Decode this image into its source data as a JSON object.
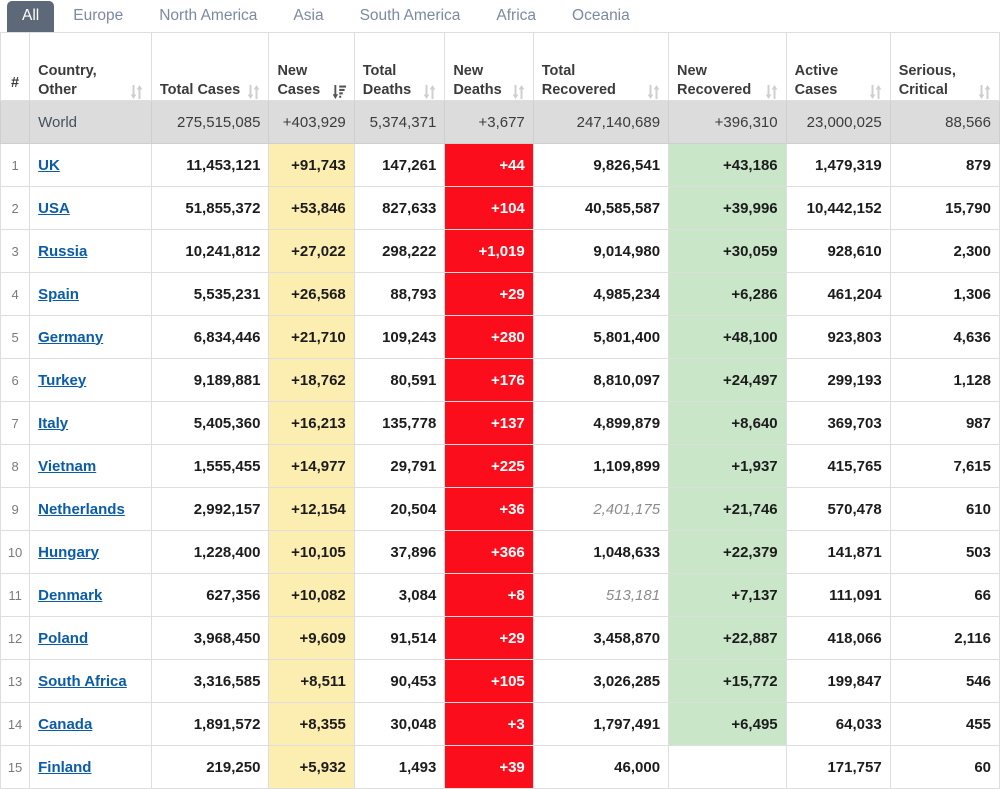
{
  "tabs": [
    {
      "label": "All",
      "active": true
    },
    {
      "label": "Europe",
      "active": false
    },
    {
      "label": "North America",
      "active": false
    },
    {
      "label": "Asia",
      "active": false
    },
    {
      "label": "South America",
      "active": false
    },
    {
      "label": "Africa",
      "active": false
    },
    {
      "label": "Oceania",
      "active": false
    }
  ],
  "colors": {
    "tab_active_bg": "#5d6878",
    "new_cases_bg": "#fcedb0",
    "new_deaths_bg": "#fc0d1b",
    "new_recovered_bg": "#c9e6c9",
    "world_row_bg": "#dcdcdc",
    "link": "#0b5ca8"
  },
  "table": {
    "headers": [
      {
        "label": "#",
        "sort": "none",
        "name": "rank"
      },
      {
        "label": "Country, Other",
        "sort": "both",
        "name": "country-other"
      },
      {
        "label": "Total Cases",
        "sort": "both",
        "name": "total-cases"
      },
      {
        "label": "New Cases",
        "sort": "desc",
        "name": "new-cases"
      },
      {
        "label": "Total Deaths",
        "sort": "both",
        "name": "total-deaths"
      },
      {
        "label": "New Deaths",
        "sort": "both",
        "name": "new-deaths"
      },
      {
        "label": "Total Recovered",
        "sort": "both",
        "name": "total-recovered"
      },
      {
        "label": "New Recovered",
        "sort": "both",
        "name": "new-recovered"
      },
      {
        "label": "Active Cases",
        "sort": "both",
        "name": "active-cases"
      },
      {
        "label": "Serious, Critical",
        "sort": "both",
        "name": "serious-critical"
      }
    ],
    "world": {
      "rank": "",
      "country": "World",
      "total_cases": "275,515,085",
      "new_cases": "+403,929",
      "total_deaths": "5,374,371",
      "new_deaths": "+3,677",
      "total_recovered": "247,140,689",
      "new_recovered": "+396,310",
      "active_cases": "23,000,025",
      "serious_critical": "88,566"
    },
    "rows": [
      {
        "rank": "1",
        "country": "UK",
        "total_cases": "11,453,121",
        "new_cases": "+91,743",
        "total_deaths": "147,261",
        "new_deaths": "+44",
        "total_recovered": "9,826,541",
        "total_recovered_muted": false,
        "new_recovered": "+43,186",
        "active_cases": "1,479,319",
        "serious_critical": "879"
      },
      {
        "rank": "2",
        "country": "USA",
        "total_cases": "51,855,372",
        "new_cases": "+53,846",
        "total_deaths": "827,633",
        "new_deaths": "+104",
        "total_recovered": "40,585,587",
        "total_recovered_muted": false,
        "new_recovered": "+39,996",
        "active_cases": "10,442,152",
        "serious_critical": "15,790"
      },
      {
        "rank": "3",
        "country": "Russia",
        "total_cases": "10,241,812",
        "new_cases": "+27,022",
        "total_deaths": "298,222",
        "new_deaths": "+1,019",
        "total_recovered": "9,014,980",
        "total_recovered_muted": false,
        "new_recovered": "+30,059",
        "active_cases": "928,610",
        "serious_critical": "2,300"
      },
      {
        "rank": "4",
        "country": "Spain",
        "total_cases": "5,535,231",
        "new_cases": "+26,568",
        "total_deaths": "88,793",
        "new_deaths": "+29",
        "total_recovered": "4,985,234",
        "total_recovered_muted": false,
        "new_recovered": "+6,286",
        "active_cases": "461,204",
        "serious_critical": "1,306"
      },
      {
        "rank": "5",
        "country": "Germany",
        "total_cases": "6,834,446",
        "new_cases": "+21,710",
        "total_deaths": "109,243",
        "new_deaths": "+280",
        "total_recovered": "5,801,400",
        "total_recovered_muted": false,
        "new_recovered": "+48,100",
        "active_cases": "923,803",
        "serious_critical": "4,636"
      },
      {
        "rank": "6",
        "country": "Turkey",
        "total_cases": "9,189,881",
        "new_cases": "+18,762",
        "total_deaths": "80,591",
        "new_deaths": "+176",
        "total_recovered": "8,810,097",
        "total_recovered_muted": false,
        "new_recovered": "+24,497",
        "active_cases": "299,193",
        "serious_critical": "1,128"
      },
      {
        "rank": "7",
        "country": "Italy",
        "total_cases": "5,405,360",
        "new_cases": "+16,213",
        "total_deaths": "135,778",
        "new_deaths": "+137",
        "total_recovered": "4,899,879",
        "total_recovered_muted": false,
        "new_recovered": "+8,640",
        "active_cases": "369,703",
        "serious_critical": "987"
      },
      {
        "rank": "8",
        "country": "Vietnam",
        "total_cases": "1,555,455",
        "new_cases": "+14,977",
        "total_deaths": "29,791",
        "new_deaths": "+225",
        "total_recovered": "1,109,899",
        "total_recovered_muted": false,
        "new_recovered": "+1,937",
        "active_cases": "415,765",
        "serious_critical": "7,615"
      },
      {
        "rank": "9",
        "country": "Netherlands",
        "total_cases": "2,992,157",
        "new_cases": "+12,154",
        "total_deaths": "20,504",
        "new_deaths": "+36",
        "total_recovered": "2,401,175",
        "total_recovered_muted": true,
        "new_recovered": "+21,746",
        "active_cases": "570,478",
        "serious_critical": "610"
      },
      {
        "rank": "10",
        "country": "Hungary",
        "total_cases": "1,228,400",
        "new_cases": "+10,105",
        "total_deaths": "37,896",
        "new_deaths": "+366",
        "total_recovered": "1,048,633",
        "total_recovered_muted": false,
        "new_recovered": "+22,379",
        "active_cases": "141,871",
        "serious_critical": "503"
      },
      {
        "rank": "11",
        "country": "Denmark",
        "total_cases": "627,356",
        "new_cases": "+10,082",
        "total_deaths": "3,084",
        "new_deaths": "+8",
        "total_recovered": "513,181",
        "total_recovered_muted": true,
        "new_recovered": "+7,137",
        "active_cases": "111,091",
        "serious_critical": "66"
      },
      {
        "rank": "12",
        "country": "Poland",
        "total_cases": "3,968,450",
        "new_cases": "+9,609",
        "total_deaths": "91,514",
        "new_deaths": "+29",
        "total_recovered": "3,458,870",
        "total_recovered_muted": false,
        "new_recovered": "+22,887",
        "active_cases": "418,066",
        "serious_critical": "2,116"
      },
      {
        "rank": "13",
        "country": "South Africa",
        "total_cases": "3,316,585",
        "new_cases": "+8,511",
        "total_deaths": "90,453",
        "new_deaths": "+105",
        "total_recovered": "3,026,285",
        "total_recovered_muted": false,
        "new_recovered": "+15,772",
        "active_cases": "199,847",
        "serious_critical": "546"
      },
      {
        "rank": "14",
        "country": "Canada",
        "total_cases": "1,891,572",
        "new_cases": "+8,355",
        "total_deaths": "30,048",
        "new_deaths": "+3",
        "total_recovered": "1,797,491",
        "total_recovered_muted": false,
        "new_recovered": "+6,495",
        "active_cases": "64,033",
        "serious_critical": "455"
      },
      {
        "rank": "15",
        "country": "Finland",
        "total_cases": "219,250",
        "new_cases": "+5,932",
        "total_deaths": "1,493",
        "new_deaths": "+39",
        "total_recovered": "46,000",
        "total_recovered_muted": false,
        "new_recovered": "",
        "active_cases": "171,757",
        "serious_critical": "60"
      }
    ]
  }
}
